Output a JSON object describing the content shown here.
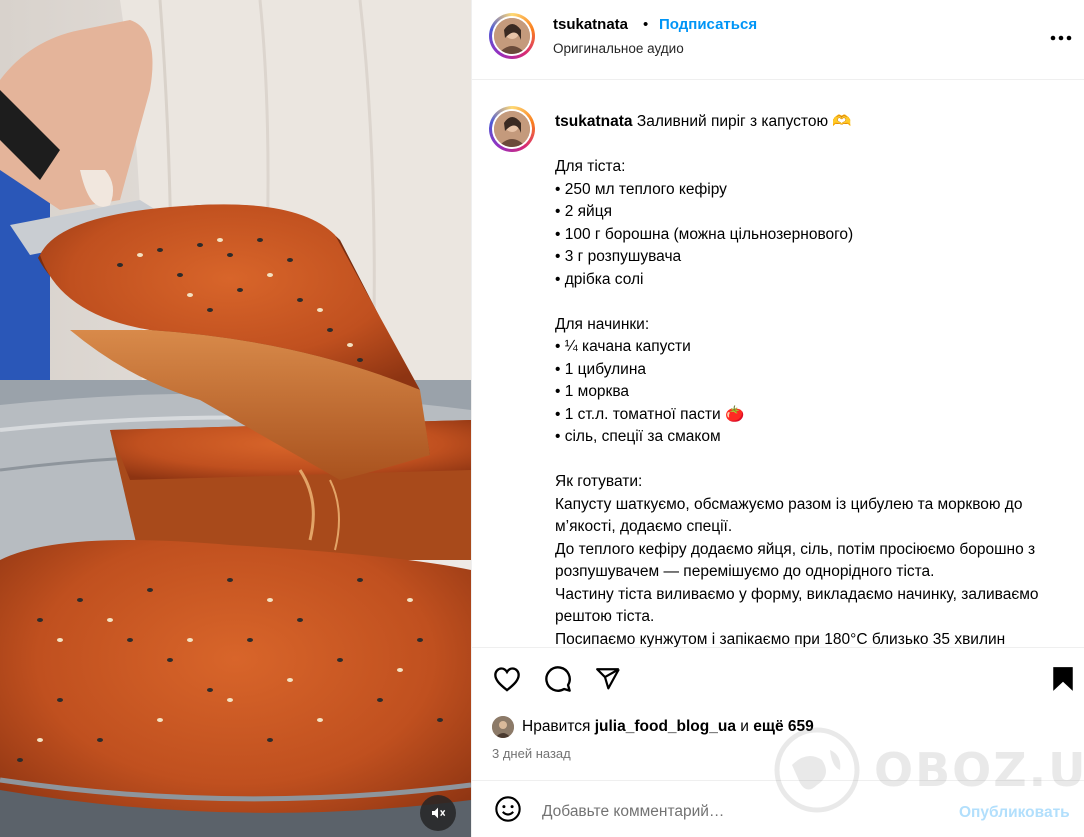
{
  "header": {
    "username": "tsukatnata",
    "separator": "•",
    "follow_label": "Подписаться",
    "audio_label": "Оригинальное аудио",
    "more_icon": "more-horizontal-icon"
  },
  "caption": {
    "username": "tsukatnata",
    "first_line": "Заливний пиріг з капустою 🫶",
    "lines": [
      "",
      "Для тіста:",
      "• 250 мл теплого кефіру",
      "• 2 яйця",
      "• 100 г борошна (можна цільнозернового)",
      "• 3 г розпушувача",
      "• дрібка солі",
      "",
      "Для начинки:",
      "• ¼ качана капусти",
      "• 1 цибулина",
      "• 1 морква",
      "• 1 ст.л. томатної пасти 🍅",
      "• сіль, спеції за смаком",
      "",
      "Як готувати:",
      "Капусту шаткуємо, обсмажуємо разом із цибулею та морквою до м’якості, додаємо спеції.",
      "До теплого кефіру додаємо яйця, сіль, потім просіюємо борошно з розпушувачем — перемішуємо до однорідного тіста.",
      "Частину тіста виливаємо у форму, викладаємо начинку, заливаємо рештою тіста.",
      "Посипаємо кунжутом і запікаємо при 180°C близько 35 хвилин"
    ]
  },
  "actions": {
    "icons": [
      "heart-icon",
      "comment-icon",
      "share-icon",
      "bookmark-icon"
    ],
    "likes_prefix": "Нравится",
    "likes_user": "julia_food_blog_ua",
    "likes_mid": "и",
    "likes_more": "ещё 659",
    "time_ago": "3 дней назад"
  },
  "comment": {
    "placeholder": "Добавьте комментарий…",
    "publish_label": "Опубликовать",
    "emoji_icon": "emoji-icon"
  },
  "media": {
    "mute_icon": "muted-speaker-icon"
  },
  "watermark": {
    "text": "OBOZ.UA"
  }
}
